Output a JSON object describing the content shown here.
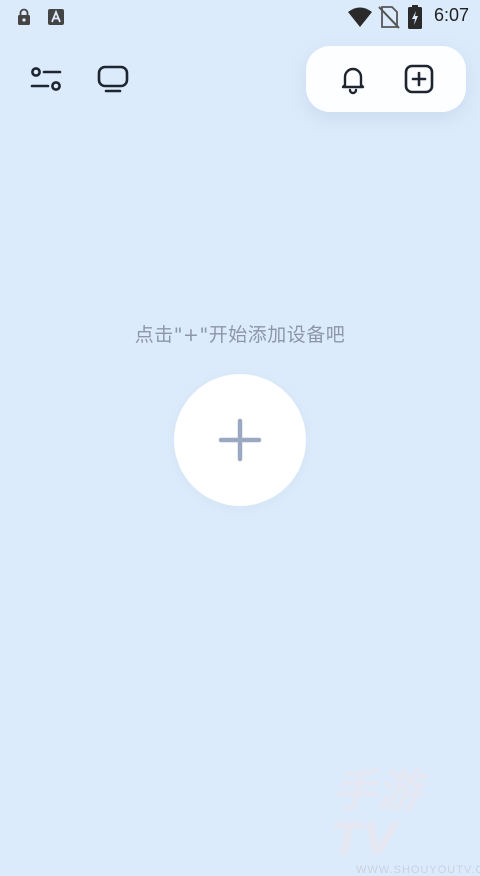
{
  "status_bar": {
    "time": "6:07",
    "left_icons": [
      "lock-notification-icon",
      "a-notification-icon"
    ],
    "right_icons": [
      "wifi-icon",
      "no-sim-icon",
      "battery-charging-icon"
    ]
  },
  "toolbar": {
    "left_icons": [
      "filter-settings-icon",
      "tv-device-icon"
    ],
    "right_icons": [
      "bell-icon",
      "add-square-icon"
    ]
  },
  "empty_state": {
    "hint": "点击\"+\"开始添加设备吧",
    "add_icon": "plus-icon"
  },
  "watermark": {
    "main": "手游TV",
    "sub": "WWW.SHOUYOUTV.COM"
  },
  "colors": {
    "background": "#dcebfb",
    "icon": "#1e2430",
    "hint_text": "#8c97a8",
    "plus": "#9aa8c2"
  }
}
